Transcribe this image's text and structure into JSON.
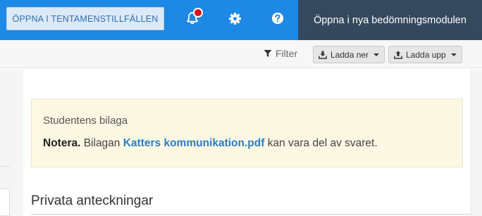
{
  "header": {
    "open_occasions_label": "ÖPPNA I TENTAMENSTILLFÄLLEN",
    "new_module_label": "Öppna i nya bedömningsmodulen",
    "icons": [
      "bell-icon",
      "gear-icon",
      "help-icon"
    ],
    "colors": {
      "bar": "#1e88e5",
      "new_module_bg": "#34495e",
      "notification_dot": "#e0101a"
    }
  },
  "toolbar": {
    "filter_label": "Filter",
    "download_label": "Ladda ner",
    "upload_label": "Ladda upp"
  },
  "notice": {
    "title": "Studentens bilaga",
    "note_label": "Notera.",
    "text_before": " Bilagan ",
    "attachment_name": "Katters kommunikation.pdf",
    "text_after": " kan vara del av svaret.",
    "background": "#fcf8e3"
  },
  "private_notes": {
    "title": "Privata anteckningar"
  }
}
